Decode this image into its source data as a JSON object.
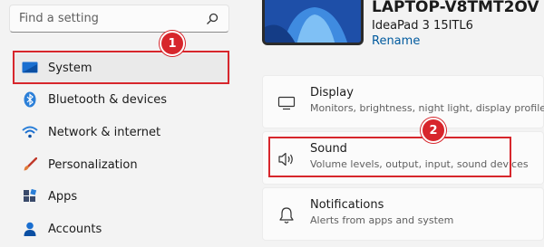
{
  "search": {
    "placeholder": "Find a setting"
  },
  "sidebar": {
    "items": [
      {
        "label": "System",
        "active": true
      },
      {
        "label": "Bluetooth & devices"
      },
      {
        "label": "Network & internet"
      },
      {
        "label": "Personalization"
      },
      {
        "label": "Apps"
      },
      {
        "label": "Accounts"
      }
    ]
  },
  "device": {
    "name": "LAPTOP-V8TMT2OV",
    "model": "IdeaPad 3 15ITL6",
    "rename_label": "Rename"
  },
  "cards": [
    {
      "title": "Display",
      "description": "Monitors, brightness, night light, display profile"
    },
    {
      "title": "Sound",
      "description": "Volume levels, output, input, sound devices"
    },
    {
      "title": "Notifications",
      "description": "Alerts from apps and system"
    }
  ],
  "annotations": {
    "step1": "1",
    "step2": "2"
  },
  "colors": {
    "accent": "#0067c0",
    "highlight": "#d7262c",
    "link": "#005a9e"
  }
}
